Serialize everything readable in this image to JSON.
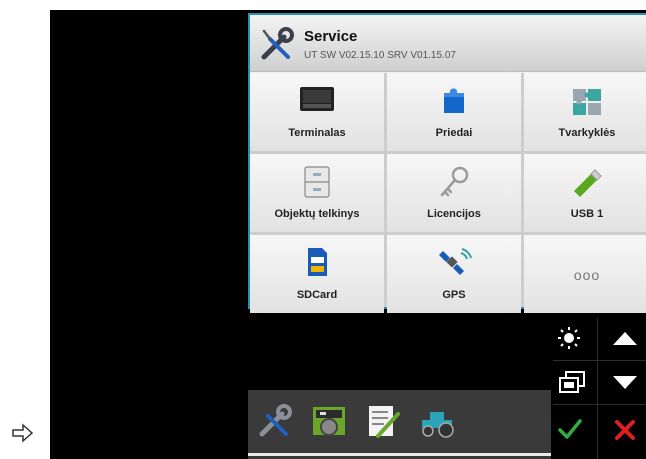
{
  "header": {
    "title": "Service",
    "subtitle": "UT SW V02.15.10 SRV V01.15.07",
    "icon": "wrench-screwdriver-icon"
  },
  "tiles": [
    {
      "label": "Terminalas",
      "icon": "terminal-icon"
    },
    {
      "label": "Priedai",
      "icon": "puzzle-icon"
    },
    {
      "label": "Tvarkyklės",
      "icon": "drivers-puzzle-icon"
    },
    {
      "label": "Objektų telkinys",
      "icon": "cabinet-icon"
    },
    {
      "label": "Licencijos",
      "icon": "key-icon"
    },
    {
      "label": "USB 1",
      "icon": "usb-stick-icon"
    },
    {
      "label": "SDCard",
      "icon": "sdcard-icon"
    },
    {
      "label": "GPS",
      "icon": "satellite-icon"
    },
    {
      "label": "ooo",
      "icon": "more-icon"
    }
  ],
  "taskbar": {
    "items": [
      "service-icon",
      "dashboard-icon",
      "checklist-icon",
      "tractor-icon"
    ]
  },
  "side_buttons": [
    "brightness-icon",
    "arrow-up-icon",
    "switch-window-icon",
    "arrow-down-icon",
    "confirm-check-icon",
    "cancel-x-icon"
  ],
  "colors": {
    "panel_border": "#2b8fb3",
    "confirm": "#2fae3e",
    "cancel": "#e02020"
  }
}
